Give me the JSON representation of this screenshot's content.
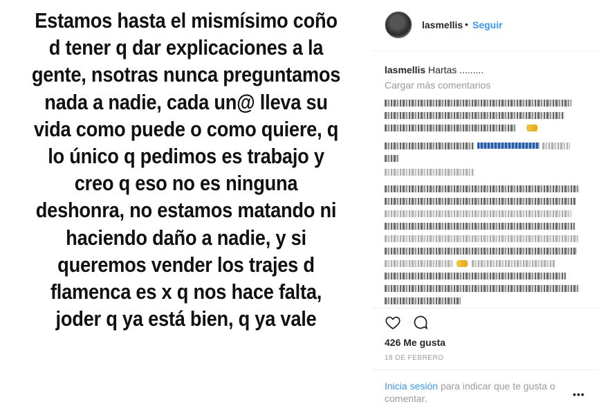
{
  "post": {
    "story_text": "Estamos hasta el mismísimo coño d tener q dar explicaciones a la gente, nsotras nunca preguntamos nada a nadie, cada un@ lleva su vida como puede o como quiere, q lo único q pedimos es trabajo y creo q eso no es ninguna deshonra, no estamos matando ni haciendo daño a nadie, y si queremos vender los trajes d flamenca es x q nos hace falta, joder q ya está bien, q ya vale"
  },
  "header": {
    "username": "lasmellis",
    "separator": "•",
    "follow_label": "Seguir"
  },
  "caption": {
    "username": "lasmellis",
    "text": "Hartas ........."
  },
  "comments": {
    "load_more": "Cargar más comentarios"
  },
  "actions": {
    "like_icon": "heart-icon",
    "comment_icon": "comment-bubble-icon"
  },
  "likes": {
    "text": "426 Me gusta"
  },
  "date": {
    "text": "18 DE FEBRERO"
  },
  "footer": {
    "login_link": "Inicia sesión",
    "login_rest": "para indicar que te gusta o comentar.",
    "more_label": "•••"
  },
  "colors": {
    "link_blue": "#3897f0",
    "muted_gray": "#999999",
    "text_dark": "#262626"
  }
}
